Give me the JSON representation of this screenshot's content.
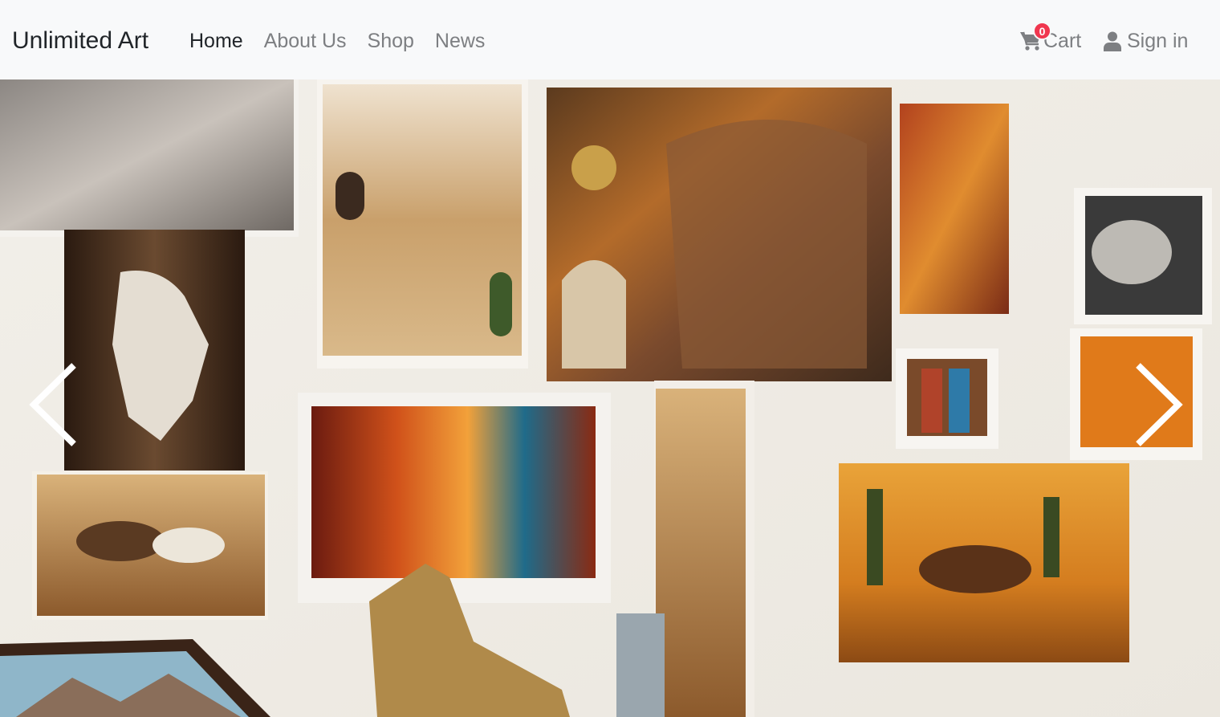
{
  "brand": "Unlimited Art",
  "nav": {
    "home": "Home",
    "about": "About Us",
    "shop": "Shop",
    "news": "News"
  },
  "cart": {
    "label": "Cart",
    "count": "0"
  },
  "signin": {
    "label": "Sign in"
  },
  "carousel": {
    "prev_icon": "chevron-left-icon",
    "next_icon": "chevron-right-icon"
  },
  "colors": {
    "navbar_bg": "#f8f9fa",
    "active_link": "#212529",
    "muted_link": "#7d7f82",
    "badge": "#f0364e"
  }
}
